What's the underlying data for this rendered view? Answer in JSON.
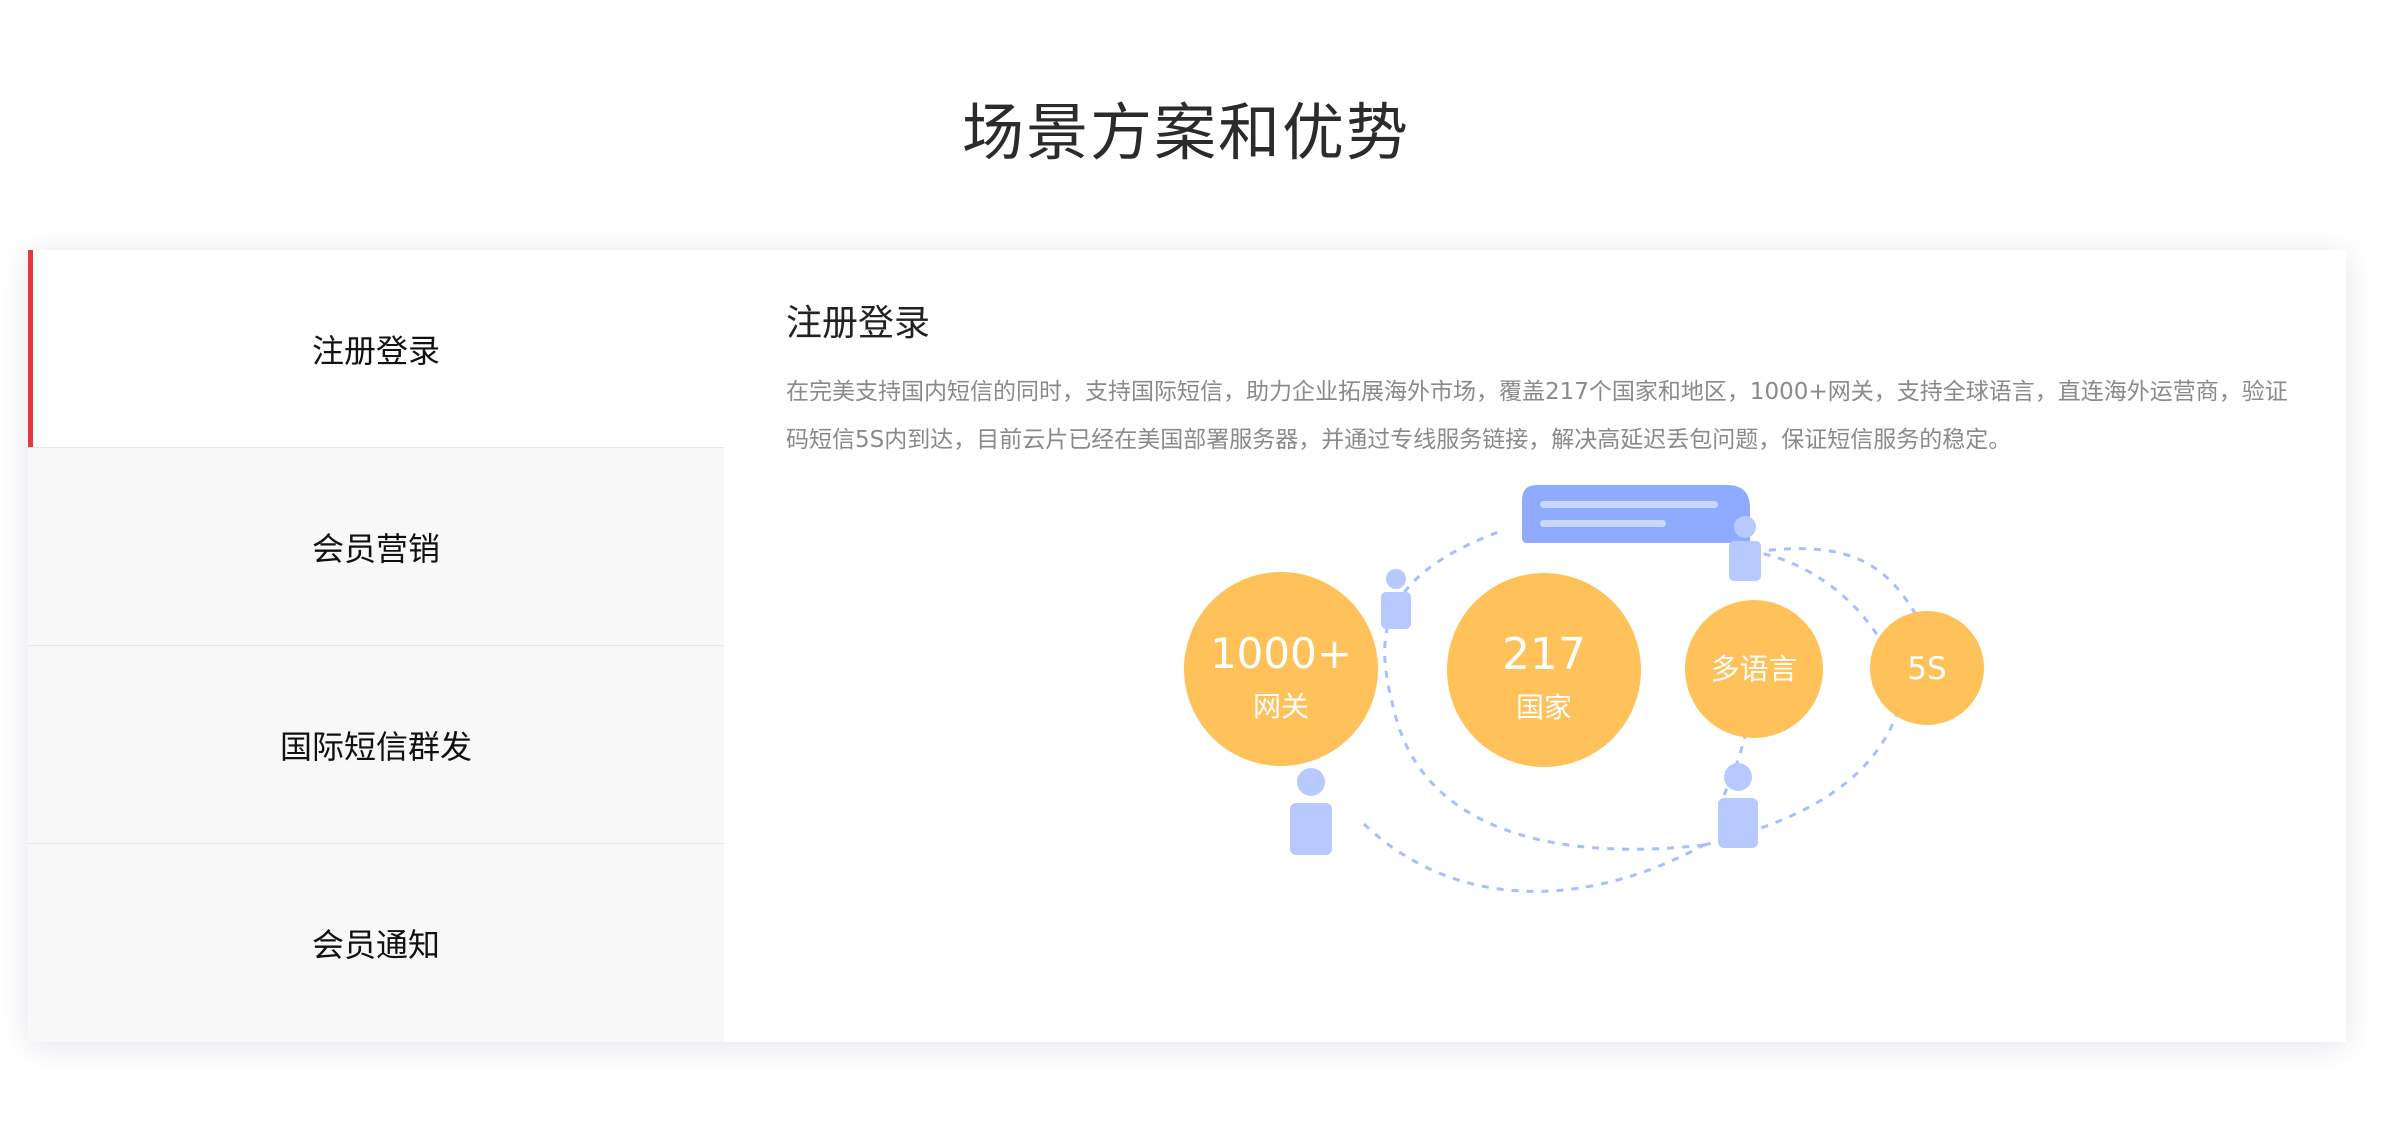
{
  "page": {
    "title": "场景方案和优势"
  },
  "tabs": [
    {
      "label": "注册登录",
      "active": true
    },
    {
      "label": "会员营销",
      "active": false
    },
    {
      "label": "国际短信群发",
      "active": false
    },
    {
      "label": "会员通知",
      "active": false
    }
  ],
  "content": {
    "title": "注册登录",
    "description": "在完美支持国内短信的同时，支持国际短信，助力企业拓展海外市场，覆盖217个国家和地区，1000+网关，支持全球语言，直连海外运营商，验证码短信5S内到达，目前云片已经在美国部署服务器，并通过专线服务链接，解决高延迟丢包问题，保证短信服务的稳定。"
  },
  "illustration": {
    "bubbles": [
      {
        "main": "1000+",
        "sub": "网关"
      },
      {
        "main": "217",
        "sub": "国家"
      },
      {
        "main": "多语言",
        "sub": ""
      },
      {
        "main": "5S",
        "sub": ""
      }
    ],
    "colors": {
      "bubble": "#FFC25A",
      "person": "#B8C9FF",
      "message": "#8FABFF",
      "accent_tab": "#E4393C"
    }
  }
}
